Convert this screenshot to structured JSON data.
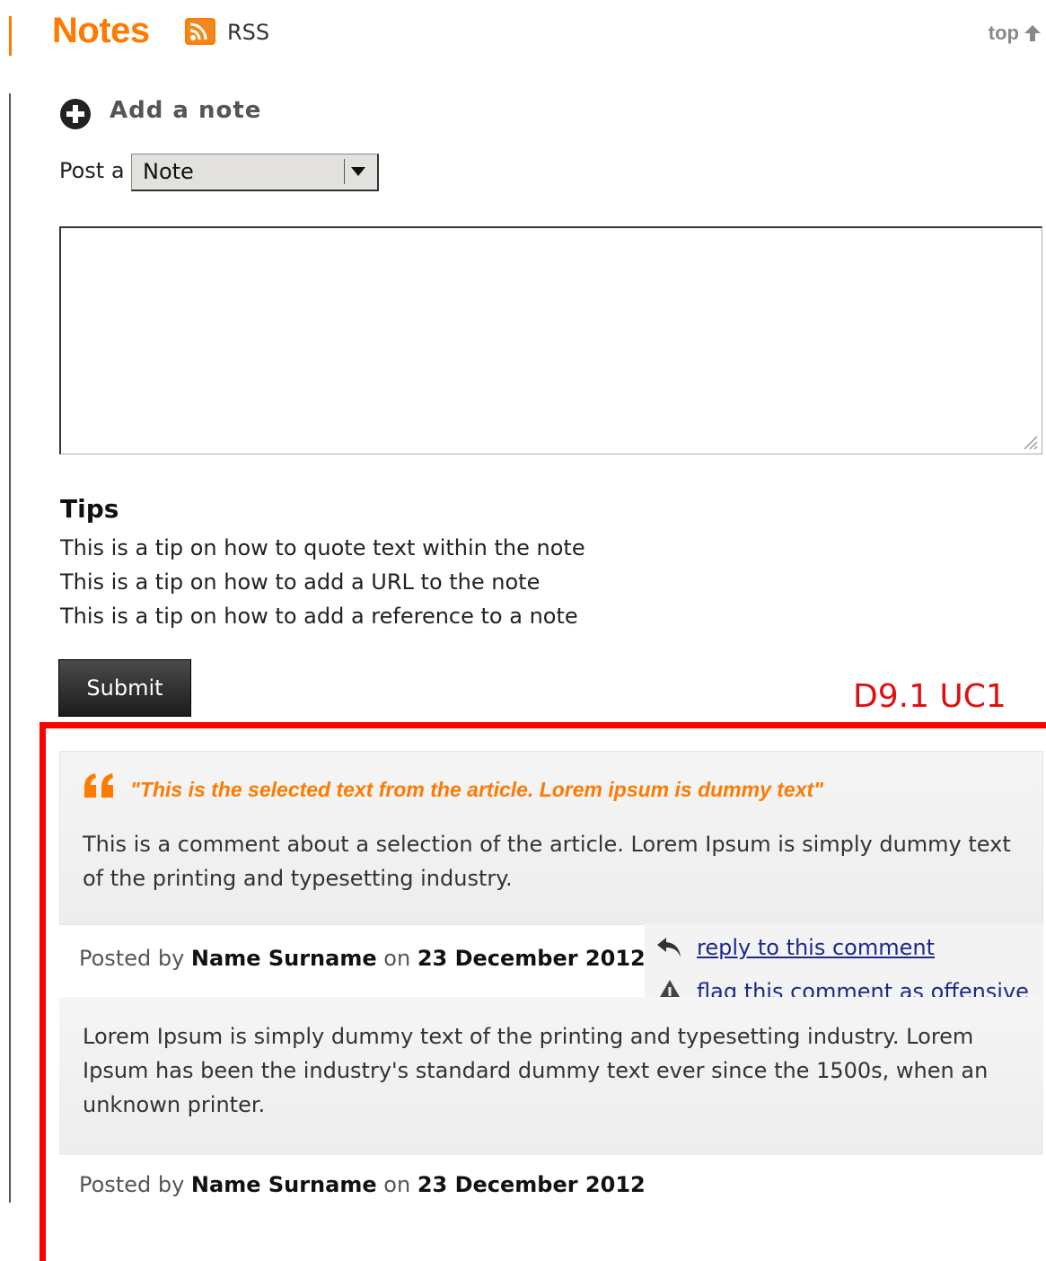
{
  "header": {
    "title": "Notes",
    "rss_label": "RSS",
    "top_label": "top"
  },
  "form": {
    "add_note_label": "Add a note",
    "post_label": "Post a",
    "type_selected": "Note",
    "tips_heading": "Tips",
    "tips": [
      "This is a tip on how to quote text within the note",
      "This is a tip on how to add a URL to the note",
      "This is a tip on how to add a reference to a note"
    ],
    "submit_label": "Submit"
  },
  "annotation": {
    "label": "D9.1 UC1",
    "color": "#ff0000"
  },
  "comments": [
    {
      "quote": "\"This is the selected text from the article. Lorem ipsum is dummy text\"",
      "text_line1": "This is a comment about a selection of the article. Lorem Ipsum is simply dummy text",
      "text_line2": "of the printing and typesetting industry.",
      "posted_by": "Posted by",
      "author": "Name Surname",
      "on": "on",
      "date": "23 December 2012",
      "reply_label": "reply to this comment",
      "flag_label": "flag this comment as offensive"
    },
    {
      "text_line1": "Lorem Ipsum is simply dummy text of the printing and typesetting industry. Lorem",
      "text_line2": "Ipsum has been the industry's standard dummy text ever since the 1500s, when an",
      "text_line3": "unknown printer.",
      "posted_by": "Posted by",
      "author": "Name Surname",
      "on": "on",
      "date": "23 December 2012"
    }
  ],
  "colors": {
    "accent": "#ff7a00",
    "link": "#1b2a8a"
  }
}
